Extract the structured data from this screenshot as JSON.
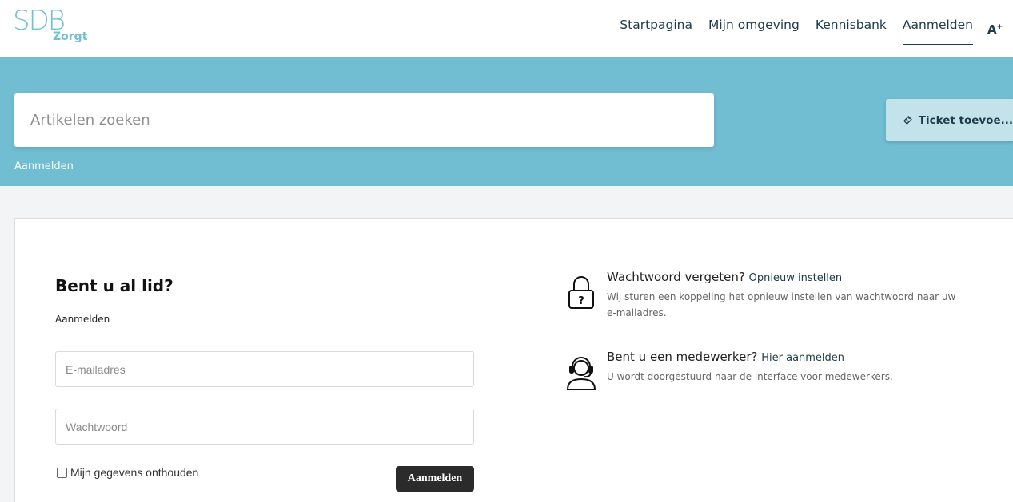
{
  "header": {
    "logo_mark": "SDB",
    "logo_sub": "Zorgt",
    "nav": [
      {
        "label": "Startpagina"
      },
      {
        "label": "Mijn omgeving"
      },
      {
        "label": "Kennisbank"
      },
      {
        "label": "Aanmelden",
        "active": true
      }
    ],
    "font_size_label": "A",
    "font_size_sup": "+"
  },
  "banner": {
    "search_placeholder": "Artikelen zoeken",
    "breadcrumb": "Aanmelden",
    "ticket_button": "Ticket toevoe..."
  },
  "login": {
    "title": "Bent u al lid?",
    "subtitle": "Aanmelden",
    "email_placeholder": "E-mailadres",
    "password_placeholder": "Wachtwoord",
    "remember_label": "Mijn gegevens onthouden",
    "remember_checked": false,
    "submit_label": "Aanmelden"
  },
  "info": {
    "forgot": {
      "heading": "Wachtwoord vergeten?",
      "link": "Opnieuw instellen",
      "description": "Wij sturen een koppeling het opnieuw instellen van wachtwoord naar uw e-mailadres.",
      "icon": "padlock-question-icon"
    },
    "employee": {
      "heading": "Bent u een medewerker?",
      "link": "Hier aanmelden",
      "description": "U wordt doorgestuurd naar de interface voor medewerkers.",
      "icon": "headset-agent-icon"
    }
  },
  "colors": {
    "accent": "#71bdd1",
    "ticket_bg": "#c3e3eb",
    "nav_text": "#1f3a4a",
    "submit_bg": "#2b2b2b"
  }
}
